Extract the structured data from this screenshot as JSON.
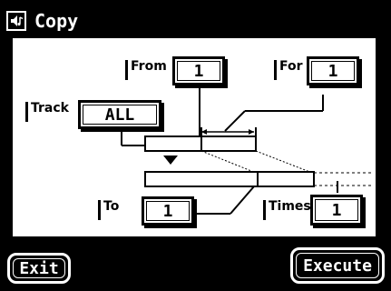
{
  "header": {
    "title": "Copy",
    "icon": "speaker-music-icon"
  },
  "fields": {
    "from": {
      "label": "From",
      "value": "1"
    },
    "for": {
      "label": "For",
      "value": "1"
    },
    "track": {
      "label": "Track",
      "value": "ALL"
    },
    "to": {
      "label": "To",
      "value": "1"
    },
    "times": {
      "label": "Times",
      "value": "1"
    }
  },
  "footer": {
    "exit_label": "Exit",
    "execute_label": "Execute"
  }
}
